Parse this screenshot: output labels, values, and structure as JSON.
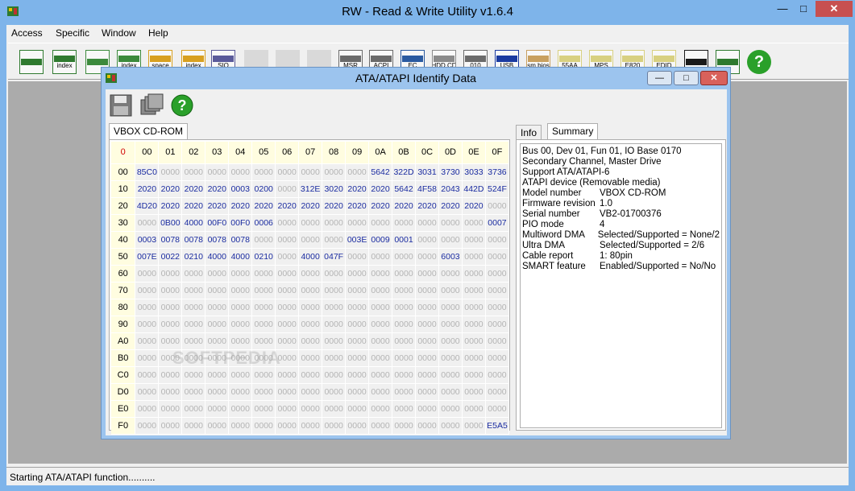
{
  "window": {
    "title": "RW - Read & Write Utility v1.6.4"
  },
  "menu": [
    "Access",
    "Specific",
    "Window",
    "Help"
  ],
  "toolbar": {
    "buttons": [
      {
        "icon": "pci-icon",
        "label": ""
      },
      {
        "icon": "pci-index-icon",
        "label": "index"
      },
      {
        "icon": "memory-icon",
        "label": ""
      },
      {
        "icon": "memory-index-icon",
        "label": "index"
      },
      {
        "icon": "io-space-icon",
        "label": "space"
      },
      {
        "icon": "io-index-icon",
        "label": "index"
      },
      {
        "icon": "sio-icon",
        "label": "SIO"
      },
      {
        "icon": "disabled-1-icon",
        "label": ""
      },
      {
        "icon": "disabled-2-icon",
        "label": ""
      },
      {
        "icon": "disabled-3-icon",
        "label": ""
      },
      {
        "icon": "msr-icon",
        "label": "MSR"
      },
      {
        "icon": "acpi-icon",
        "label": "ACPI"
      },
      {
        "icon": "ec-icon",
        "label": "EC"
      },
      {
        "icon": "hdd-cd-icon",
        "label": "HDD,CD"
      },
      {
        "icon": "hdd-010-icon",
        "label": "010"
      },
      {
        "icon": "usb-icon",
        "label": "USB"
      },
      {
        "icon": "smbios-icon",
        "label": "sm bios"
      },
      {
        "icon": "55aa-icon",
        "label": "55AA"
      },
      {
        "icon": "mps-icon",
        "label": "MPS"
      },
      {
        "icon": "e820-icon",
        "label": "E820"
      },
      {
        "icon": "edid-icon",
        "label": "EDID"
      },
      {
        "icon": "command-icon",
        "label": ""
      },
      {
        "icon": "pci-card-icon",
        "label": ""
      },
      {
        "icon": "help-icon",
        "label": "?"
      }
    ]
  },
  "status": "Starting ATA/ATAPI function..........",
  "child": {
    "title": "ATA/ATAPI Identify Data",
    "tab_device": "VBOX CD-ROM",
    "tab_info": "Info",
    "tab_summary": "Summary",
    "corner": "0",
    "columns": [
      "00",
      "01",
      "02",
      "03",
      "04",
      "05",
      "06",
      "07",
      "08",
      "09",
      "0A",
      "0B",
      "0C",
      "0D",
      "0E",
      "0F"
    ],
    "rows": [
      {
        "label": "00",
        "cells": [
          "85C0",
          "0000",
          "0000",
          "0000",
          "0000",
          "0000",
          "0000",
          "0000",
          "0000",
          "0000",
          "5642",
          "322D",
          "3031",
          "3730",
          "3033",
          "3736"
        ]
      },
      {
        "label": "10",
        "cells": [
          "2020",
          "2020",
          "2020",
          "2020",
          "0003",
          "0200",
          "0000",
          "312E",
          "3020",
          "2020",
          "2020",
          "5642",
          "4F58",
          "2043",
          "442D",
          "524F"
        ]
      },
      {
        "label": "20",
        "cells": [
          "4D20",
          "2020",
          "2020",
          "2020",
          "2020",
          "2020",
          "2020",
          "2020",
          "2020",
          "2020",
          "2020",
          "2020",
          "2020",
          "2020",
          "2020",
          "0000"
        ]
      },
      {
        "label": "30",
        "cells": [
          "0000",
          "0B00",
          "4000",
          "00F0",
          "00F0",
          "0006",
          "0000",
          "0000",
          "0000",
          "0000",
          "0000",
          "0000",
          "0000",
          "0000",
          "0000",
          "0007"
        ]
      },
      {
        "label": "40",
        "cells": [
          "0003",
          "0078",
          "0078",
          "0078",
          "0078",
          "0000",
          "0000",
          "0000",
          "0000",
          "003E",
          "0009",
          "0001",
          "0000",
          "0000",
          "0000",
          "0000"
        ]
      },
      {
        "label": "50",
        "cells": [
          "007E",
          "0022",
          "0210",
          "4000",
          "4000",
          "0210",
          "0000",
          "4000",
          "047F",
          "0000",
          "0000",
          "0000",
          "0000",
          "6003",
          "0000",
          "0000"
        ]
      },
      {
        "label": "60",
        "cells": [
          "0000",
          "0000",
          "0000",
          "0000",
          "0000",
          "0000",
          "0000",
          "0000",
          "0000",
          "0000",
          "0000",
          "0000",
          "0000",
          "0000",
          "0000",
          "0000"
        ]
      },
      {
        "label": "70",
        "cells": [
          "0000",
          "0000",
          "0000",
          "0000",
          "0000",
          "0000",
          "0000",
          "0000",
          "0000",
          "0000",
          "0000",
          "0000",
          "0000",
          "0000",
          "0000",
          "0000"
        ]
      },
      {
        "label": "80",
        "cells": [
          "0000",
          "0000",
          "0000",
          "0000",
          "0000",
          "0000",
          "0000",
          "0000",
          "0000",
          "0000",
          "0000",
          "0000",
          "0000",
          "0000",
          "0000",
          "0000"
        ]
      },
      {
        "label": "90",
        "cells": [
          "0000",
          "0000",
          "0000",
          "0000",
          "0000",
          "0000",
          "0000",
          "0000",
          "0000",
          "0000",
          "0000",
          "0000",
          "0000",
          "0000",
          "0000",
          "0000"
        ]
      },
      {
        "label": "A0",
        "cells": [
          "0000",
          "0000",
          "0000",
          "0000",
          "0000",
          "0000",
          "0000",
          "0000",
          "0000",
          "0000",
          "0000",
          "0000",
          "0000",
          "0000",
          "0000",
          "0000"
        ]
      },
      {
        "label": "B0",
        "cells": [
          "0000",
          "0000",
          "0000",
          "0000",
          "0000",
          "0000",
          "0000",
          "0000",
          "0000",
          "0000",
          "0000",
          "0000",
          "0000",
          "0000",
          "0000",
          "0000"
        ]
      },
      {
        "label": "C0",
        "cells": [
          "0000",
          "0000",
          "0000",
          "0000",
          "0000",
          "0000",
          "0000",
          "0000",
          "0000",
          "0000",
          "0000",
          "0000",
          "0000",
          "0000",
          "0000",
          "0000"
        ]
      },
      {
        "label": "D0",
        "cells": [
          "0000",
          "0000",
          "0000",
          "0000",
          "0000",
          "0000",
          "0000",
          "0000",
          "0000",
          "0000",
          "0000",
          "0000",
          "0000",
          "0000",
          "0000",
          "0000"
        ]
      },
      {
        "label": "E0",
        "cells": [
          "0000",
          "0000",
          "0000",
          "0000",
          "0000",
          "0000",
          "0000",
          "0000",
          "0000",
          "0000",
          "0000",
          "0000",
          "0000",
          "0000",
          "0000",
          "0000"
        ]
      },
      {
        "label": "F0",
        "cells": [
          "0000",
          "0000",
          "0000",
          "0000",
          "0000",
          "0000",
          "0000",
          "0000",
          "0000",
          "0000",
          "0000",
          "0000",
          "0000",
          "0000",
          "0000",
          "E5A5"
        ]
      }
    ],
    "summary_lines": [
      "Bus 00, Dev 01, Fun 01, IO Base 0170",
      "Secondary Channel, Master Drive",
      "Support ATA/ATAPI-6",
      "ATAPI device (Removable media)"
    ],
    "summary_kv": [
      {
        "k": "Model number",
        "v": "VBOX CD-ROM"
      },
      {
        "k": "Firmware revision",
        "v": "1.0"
      },
      {
        "k": "Serial number",
        "v": "VB2-01700376"
      },
      {
        "k": "PIO mode",
        "v": "4"
      },
      {
        "k": "Multiword DMA",
        "v": "Selected/Supported = None/2"
      },
      {
        "k": "Ultra DMA",
        "v": "Selected/Supported = 2/6"
      },
      {
        "k": "Cable report",
        "v": "1: 80pin"
      },
      {
        "k": "SMART feature",
        "v": "Enabled/Supported = No/No"
      }
    ],
    "watermark": "SOFTPEDIA"
  }
}
